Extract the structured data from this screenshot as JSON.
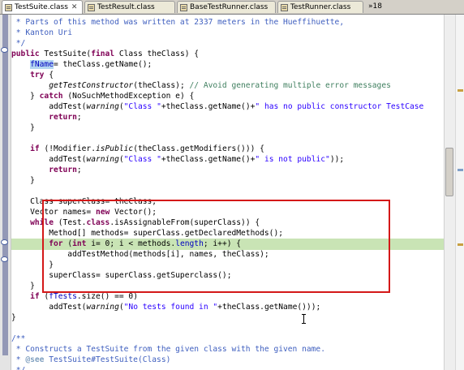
{
  "tabs": [
    {
      "label": "TestSuite.class",
      "close": "✕"
    },
    {
      "label": "TestResult.class"
    },
    {
      "label": "BaseTestRunner.class"
    },
    {
      "label": "TestRunner.class"
    }
  ],
  "tab_overflow": "»18",
  "code": {
    "l01": {
      "a": " * Parts of this method was written at 2337 meters in the Hueffihuette,"
    },
    "l02": {
      "a": " * Kanton Uri"
    },
    "l03": {
      "a": " */"
    },
    "l04": {
      "a": "public",
      "b": " TestSuite(",
      "c": "final",
      "d": " Class theClass) {"
    },
    "l05": {
      "a": "    ",
      "b": "fName",
      "c": "= theClass.getName();"
    },
    "l06": {
      "a": "    ",
      "b": "try",
      "c": " {"
    },
    "l07": {
      "a": "        ",
      "b": "getTestConstructor",
      "c": "(theClass); ",
      "d": "// Avoid generating multiple error messages"
    },
    "l08": {
      "a": "    } ",
      "b": "catch",
      "c": " (NoSuchMethodException e) {"
    },
    "l09": {
      "a": "        addTest(",
      "b": "warning",
      "c": "(",
      "d": "\"Class \"",
      "e": "+theClass.getName()+",
      "f": "\" has no public constructor TestCase"
    },
    "l10": {
      "a": "        ",
      "b": "return",
      "c": ";"
    },
    "l11": {
      "a": "    }"
    },
    "l12": {
      "a": "    ",
      "b": "if",
      "c": " (!Modifier.",
      "d": "isPublic",
      "e": "(theClass.getModifiers())) {"
    },
    "l13": {
      "a": "        addTest(",
      "b": "warning",
      "c": "(",
      "d": "\"Class \"",
      "e": "+theClass.getName()+",
      "f": "\" is not public\"",
      "g": "));"
    },
    "l14": {
      "a": "        ",
      "b": "return",
      "c": ";"
    },
    "l15": {
      "a": "    }"
    },
    "l16": {
      "a": "    Class superClass= theClass;"
    },
    "l17": {
      "a": "    Vector names= ",
      "b": "new",
      "c": " Vector();"
    },
    "l18": {
      "a": "    ",
      "b": "while",
      "c": " (Test.",
      "d": "class",
      "e": ".isAssignableFrom(superClass)) {"
    },
    "l19": {
      "a": "        Method[] methods= superClass.getDeclaredMethods();"
    },
    "l20": {
      "a": "        ",
      "b": "for",
      "c": " (",
      "d": "int",
      "e": " i= 0; i < methods.",
      "f": "length",
      "g": "; i++) {"
    },
    "l21": {
      "a": "            addTestMethod(methods[i], names, theClass);"
    },
    "l22": {
      "a": "        }"
    },
    "l23": {
      "a": "        superClass= superClass.getSuperclass();"
    },
    "l24": {
      "a": "    }"
    },
    "l25": {
      "a": "    ",
      "b": "if",
      "c": " (",
      "d": "fTests",
      "e": ".size() == 0)"
    },
    "l26": {
      "a": "        addTest(",
      "b": "warning",
      "c": "(",
      "d": "\"No tests found in \"",
      "e": "+theClass.",
      "f": "getName",
      "g": "()));"
    },
    "l27": {
      "a": "}"
    },
    "l28": {
      "a": ""
    },
    "l29": {
      "a": "/**"
    },
    "l30": {
      "a": " * Constructs a TestSuite from the given class with the given name."
    },
    "l31": {
      "a": " * ",
      "b": "@see",
      "c": " TestSuite#TestSuite(Class)"
    },
    "l32": {
      "a": " */"
    }
  },
  "colors": {
    "keyword": "#7f0055",
    "comment": "#3f5fbf",
    "line_comment": "#3f7f5f",
    "string": "#2a00ff",
    "field": "#0000c0",
    "current_line": "#c9e4b5",
    "annotation_box": "#d41818"
  }
}
